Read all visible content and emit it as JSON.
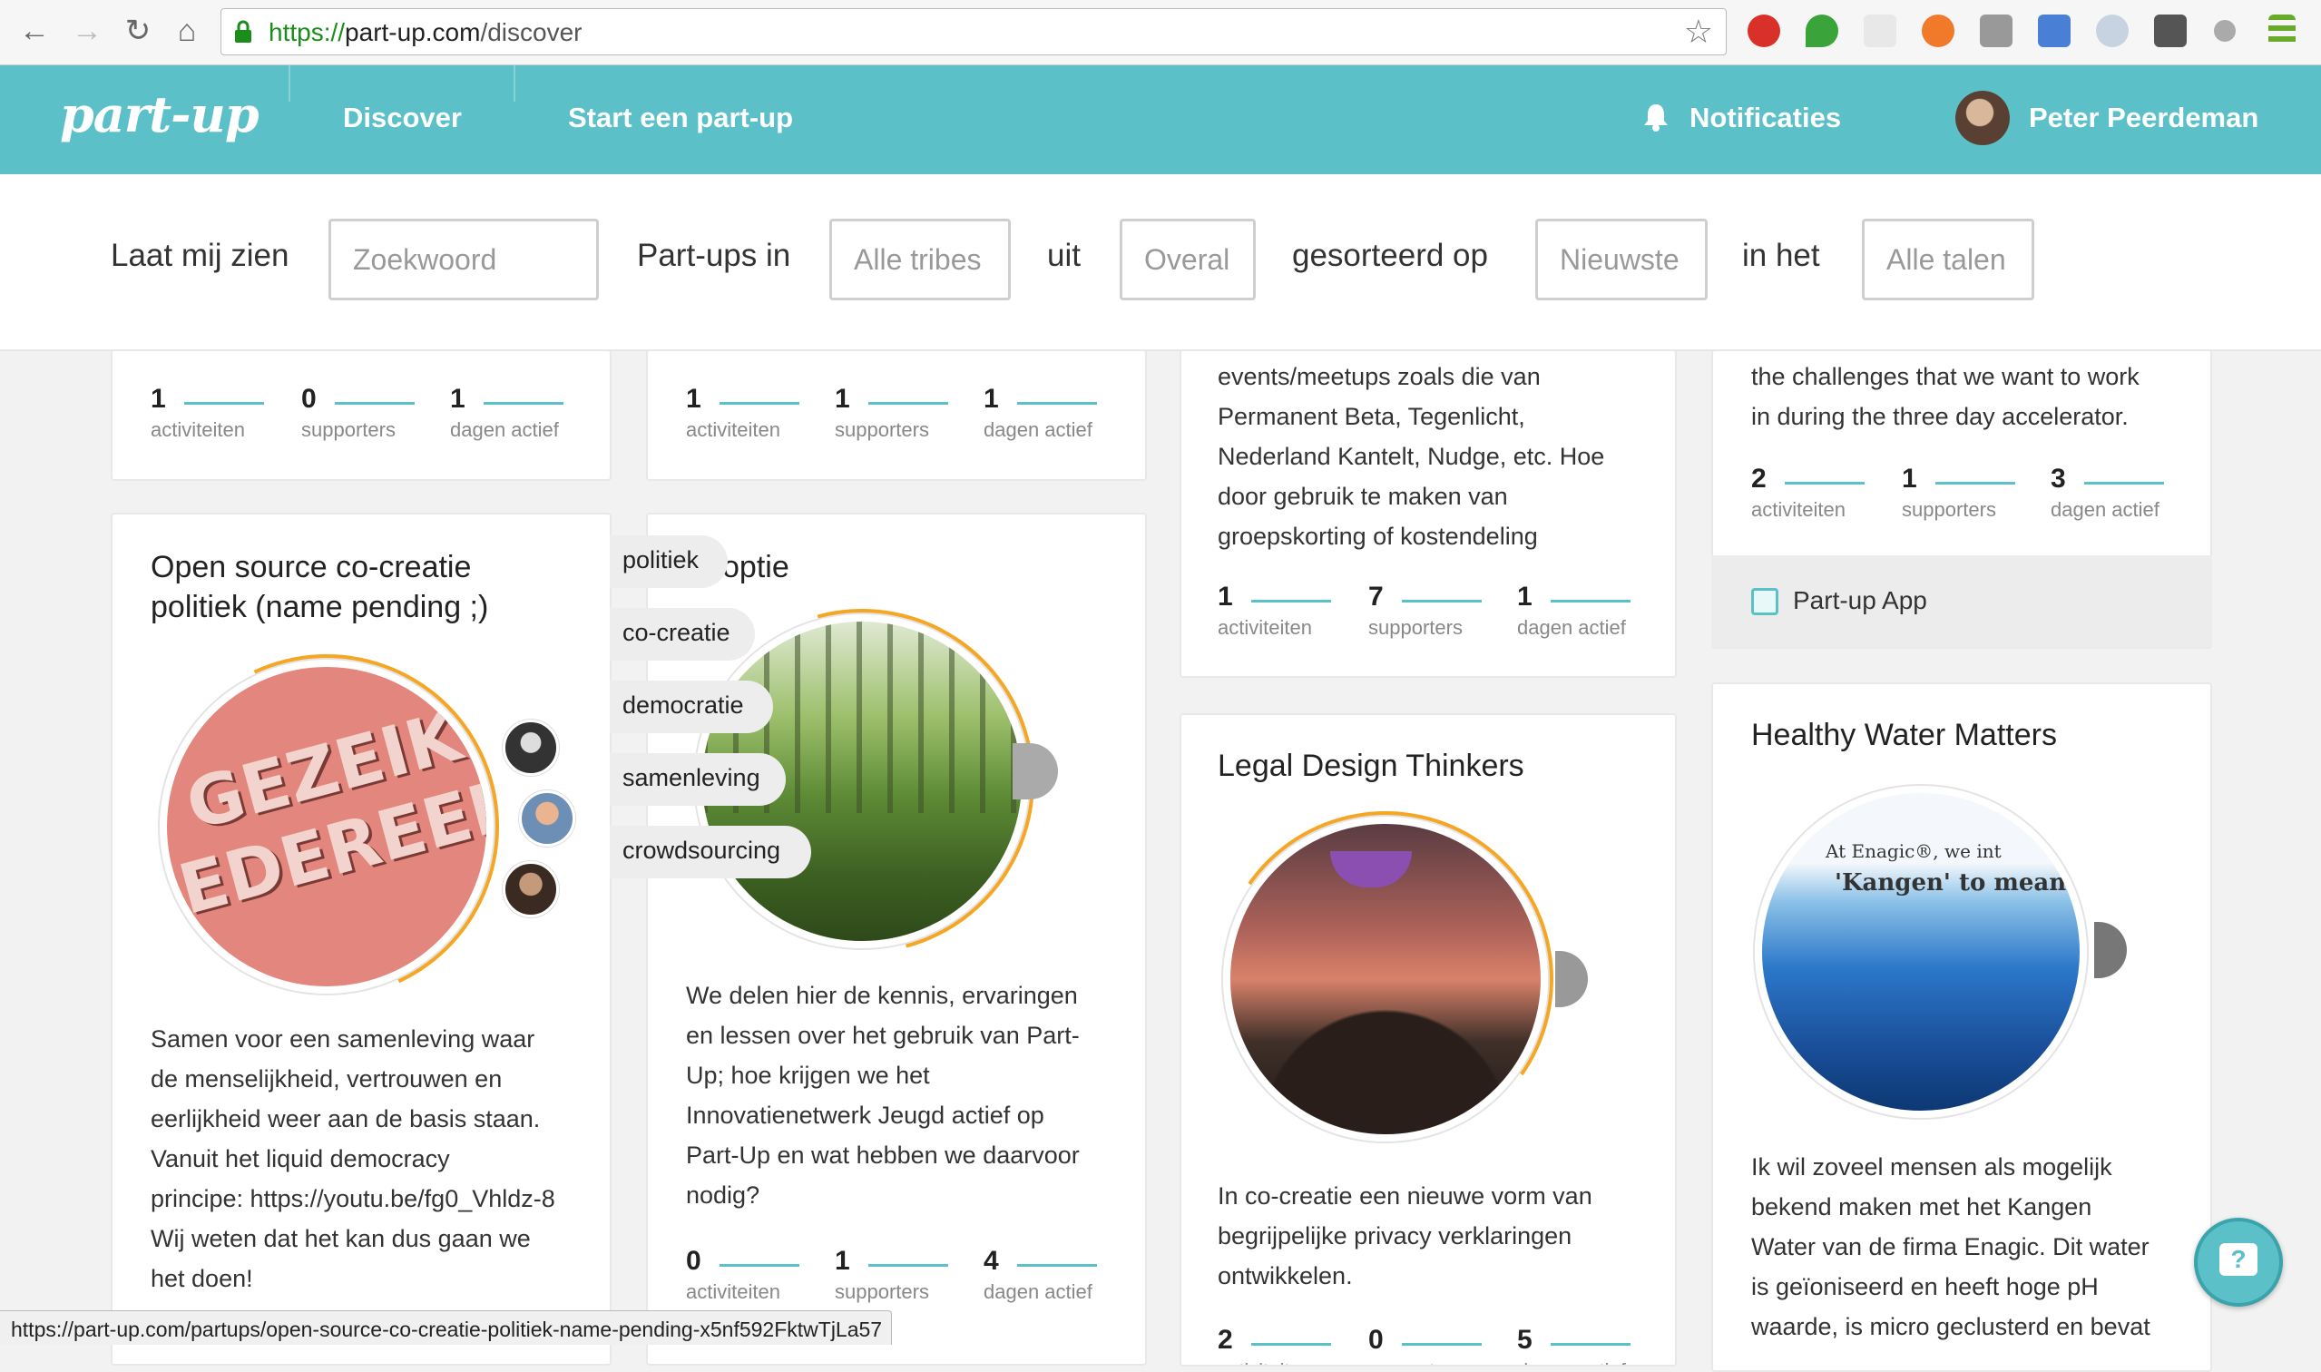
{
  "browser": {
    "url_scheme": "https://",
    "url_host": "part-up.com",
    "url_path": "/discover",
    "status_url": "https://part-up.com/partups/open-source-co-creatie-politiek-name-pending-x5nf592FktwTjLa57"
  },
  "header": {
    "logo": "part-up",
    "nav_discover": "Discover",
    "nav_start": "Start een part-up",
    "notifications": "Notificaties",
    "user_name": "Peter Peerdeman"
  },
  "filters": {
    "show_label": "Laat mij zien",
    "keyword_placeholder": "Zoekwoord",
    "partups_in_label": "Part-ups in",
    "tribes_value": "Alle tribes",
    "from_label": "uit",
    "location_value": "Overal",
    "sorted_label": "gesorteerd op",
    "sort_value": "Nieuwste",
    "in_label": "in het",
    "language_value": "Alle talen"
  },
  "stat_labels": {
    "activities": "activiteiten",
    "supporters": "supporters",
    "days": "dagen actief"
  },
  "cards": {
    "c1_top": {
      "activities": "1",
      "supporters": "0",
      "days": "1"
    },
    "c2_top": {
      "activities": "1",
      "supporters": "1",
      "days": "1"
    },
    "c3_top": {
      "desc": [
        "events/meetups zoals die van",
        "Permanent Beta, Tegenlicht,",
        "Nederland Kantelt, Nudge, etc. Hoe",
        "door gebruik te maken van",
        "groepskorting of kostendeling"
      ],
      "activities": "1",
      "supporters": "7",
      "days": "1"
    },
    "c4_top": {
      "desc": [
        "the challenges that we want to work",
        "in during the three day accelerator."
      ],
      "activities": "2",
      "supporters": "1",
      "days": "3",
      "app_label": "Part-up App"
    },
    "open_source": {
      "title_line1": "Open source co-creatie",
      "title_line2": "politiek (name pending ;)",
      "image_text_line1": "GEZEIK",
      "image_text_line2": "IEDEREEN",
      "desc": [
        "Samen voor een samenleving waar",
        "de menselijkheid, vertrouwen en",
        "eerlijkheid weer aan de basis staan.",
        "Vanuit het liquid democracy",
        "principe: https://youtu.be/fg0_Vhldz-8",
        "Wij weten dat het kan dus gaan we",
        "het doen!"
      ]
    },
    "adoptie": {
      "title_fragment": "optie",
      "tags": [
        "politiek",
        "co-creatie",
        "democratie",
        "samenleving",
        "crowdsourcing"
      ],
      "desc": [
        "We delen hier de kennis, ervaringen",
        "en lessen over het gebruik van Part-",
        "Up; hoe krijgen we het",
        "Innovatienetwerk Jeugd actief op",
        "Part-Up en wat hebben we daarvoor",
        "nodig?"
      ],
      "activities": "0",
      "supporters": "1",
      "days": "4"
    },
    "legal": {
      "title": "Legal Design Thinkers",
      "desc": [
        "In co-creatie een nieuwe vorm van",
        "begrijpelijke privacy verklaringen",
        "ontwikkelen."
      ],
      "activities": "2",
      "supporters": "0",
      "days": "5"
    },
    "water": {
      "title": "Healthy Water Matters",
      "image_text_line1": "At Enagic®, we int",
      "image_text_line2": "'Kangen' to mean",
      "desc": [
        "Ik wil zoveel mensen als mogelijk",
        "bekend maken met het Kangen",
        "Water van de firma Enagic. Dit water",
        "is geïoniseerd en heeft hoge pH",
        "waarde, is micro geclusterd en bevat"
      ]
    }
  },
  "colors": {
    "accent": "#5bc0c8",
    "progress": "#f5a623",
    "chat_icon": "?"
  }
}
